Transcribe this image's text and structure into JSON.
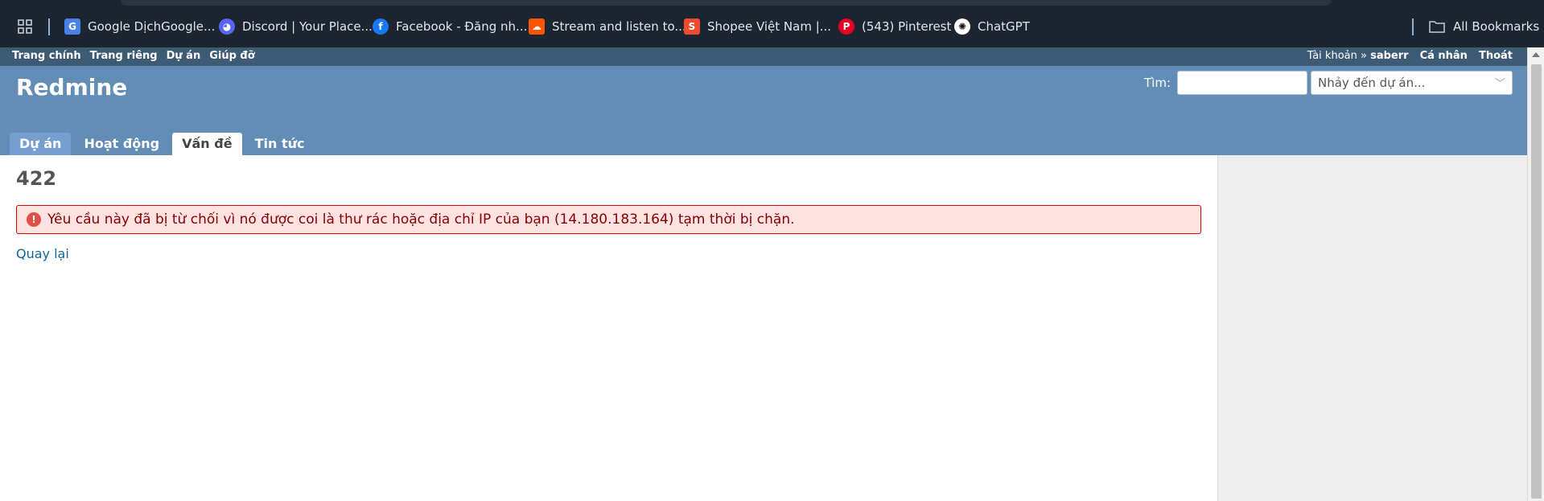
{
  "bookmarks": {
    "apps_icon": "apps-grid-icon",
    "items": [
      {
        "label": "Google DịchGoogle...",
        "icon": "google-translate-icon",
        "color": "#4a80e8"
      },
      {
        "label": "Discord | Your Place...",
        "icon": "discord-icon",
        "color": "#5865f2"
      },
      {
        "label": "Facebook - Đăng nh...",
        "icon": "facebook-icon",
        "color": "#1877f2"
      },
      {
        "label": "Stream and listen to...",
        "icon": "soundcloud-icon",
        "color": "#ff5500"
      },
      {
        "label": "Shopee Việt Nam |...",
        "icon": "shopee-icon",
        "color": "#ee4d2d"
      },
      {
        "label": "(543) Pinterest",
        "icon": "pinterest-icon",
        "color": "#e60023"
      },
      {
        "label": "ChatGPT",
        "icon": "chatgpt-icon",
        "color": "#ffffff"
      }
    ],
    "all_bookmarks": "All Bookmarks"
  },
  "top_menu": {
    "left": [
      "Trang chính",
      "Trang riêng",
      "Dự án",
      "Giúp đỡ"
    ],
    "account_prefix": "Tài khoản »",
    "account_user": "saberr",
    "my_account": "Cá nhân",
    "logout": "Thoát"
  },
  "header": {
    "title": "Redmine",
    "search_label": "Tìm:",
    "search_value": "",
    "project_jump": "Nhảy đến dự án..."
  },
  "tabs": [
    "Dự án",
    "Hoạt động",
    "Vấn đề",
    "Tin tức"
  ],
  "selected_tab": "Vấn đề",
  "content": {
    "title": "422",
    "error": "Yêu cầu này đã bị từ chối vì nó được coi là thư rác hoặc địa chỉ IP của bạn (14.180.183.164) tạm thời bị chặn.",
    "back": "Quay lại"
  },
  "colors": {
    "header": "#628db6",
    "top_menu": "#3e5b76",
    "flash_bg": "#ffe3e3",
    "flash_text": "#880000",
    "link": "#116699"
  }
}
